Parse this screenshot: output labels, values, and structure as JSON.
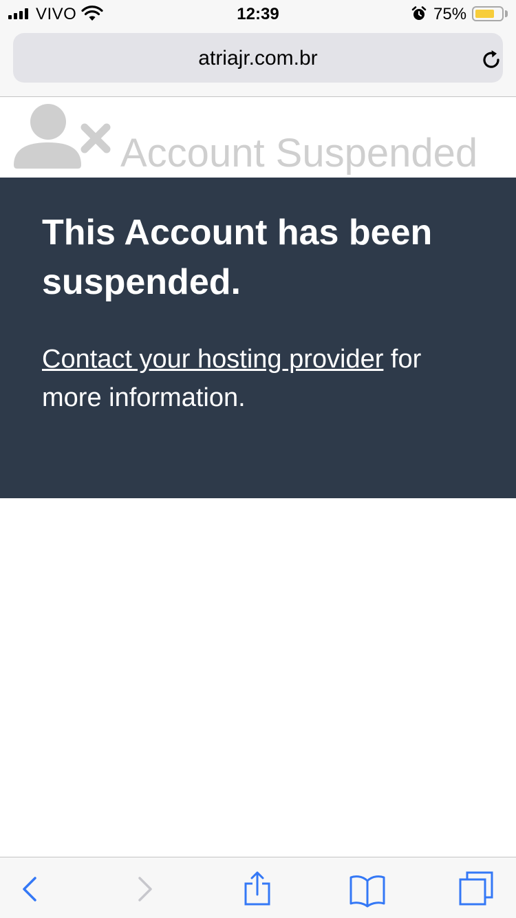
{
  "status_bar": {
    "carrier": "VIVO",
    "time": "12:39",
    "battery_percent_text": "75%",
    "battery_level": 0.75,
    "icons": [
      "signal-icon",
      "wifi-icon",
      "alarm-icon",
      "battery-icon"
    ]
  },
  "address_bar": {
    "url": "atriajr.com.br",
    "reload_icon": "reload-icon"
  },
  "page": {
    "header_title": "Account Suspended",
    "header_icon": "user-remove-icon",
    "heading": "This Account has been suspended.",
    "link_text": "Contact your hosting provider",
    "message_rest": " for more information."
  },
  "toolbar": {
    "icons": [
      "back-icon",
      "forward-icon",
      "share-icon",
      "bookmarks-icon",
      "tabs-icon"
    ]
  },
  "colors": {
    "panel_bg": "#2e3a4a",
    "header_text": "#cfcfcf",
    "ios_blue": "#3478f6",
    "battery_yellow": "#f7cd3b"
  }
}
